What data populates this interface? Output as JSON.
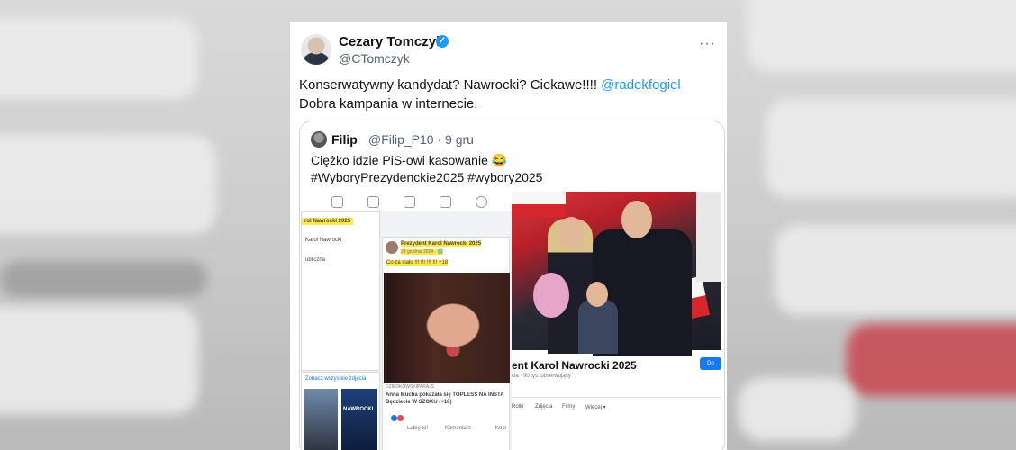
{
  "tweet": {
    "author_name": "Cezary Tomczyk",
    "author_handle": "@CTomczyk",
    "more_label": "···",
    "text_before_mention": "Konserwatywny kandydat? Nawrocki? Ciekawe!!!! ",
    "mention": "@radekfogiel",
    "text_after_mention": " Dobra kampania w internecie."
  },
  "quote": {
    "author_name": "Filip",
    "author_handle": "@Filip_P10 · 9 gru",
    "line1": "Ciężko idzie PiS-owi kasowanie 😂",
    "line2": "#WyboryPrezydenckie2025 #wybory2025"
  },
  "media_left": {
    "search_value": "rol Nawrocki 2025",
    "search_result": "Karol Nawrocki",
    "sidebar_item": "ubliczna",
    "post_author": "Prezydent Karol Nawrocki 2025",
    "post_date": "24 grudnia 2024 · 🌐",
    "post_text": "Co za ciało !!! !!! !!! !!! +18",
    "see_all_photos": "Zobacz wszystkie zdjęcia",
    "photo_caption": "NAWROCKI",
    "link_domain": "DZIEDKOWSKIPARAJS",
    "link_title": "Anna Mucha pokazała się TOPLESS NA INSTA Będziecie W SZOKU (+18)",
    "action_like": "Lubię to!",
    "action_comment": "Komentarz",
    "action_copy": "Kopi"
  },
  "media_right": {
    "page_title": "ent Karol Nawrocki 2025",
    "page_sub": "cia · 90 tys. obserwujący",
    "button_label": "Do",
    "tabs": [
      "Rolki",
      "Zdjęcia",
      "Filmy",
      "Więcej ▾"
    ]
  },
  "colors": {
    "link": "#1d9bf0",
    "verified": "#1d9bf0",
    "highlight": "#ffe94a"
  }
}
